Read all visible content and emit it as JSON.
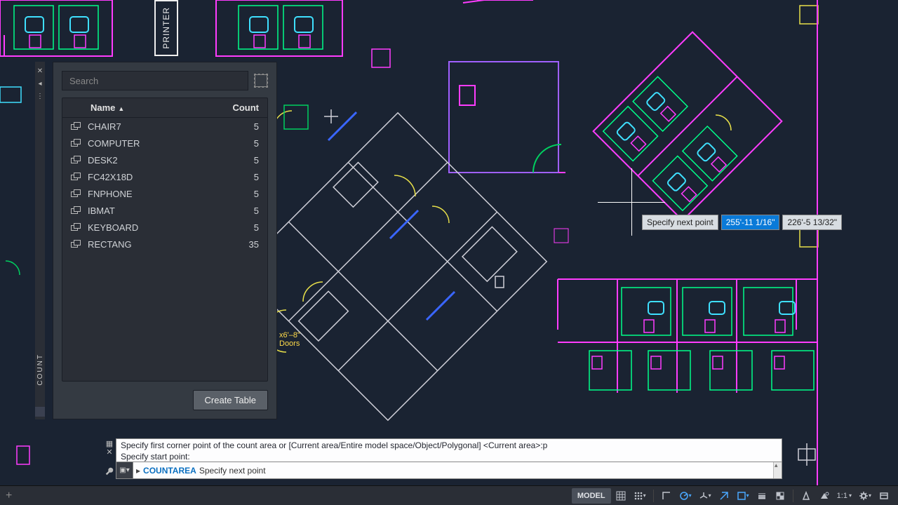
{
  "panel": {
    "side_label": "COUNT",
    "search_placeholder": "Search",
    "columns": {
      "name": "Name",
      "count": "Count"
    },
    "rows": [
      {
        "name": "CHAIR7",
        "count": "5"
      },
      {
        "name": "COMPUTER",
        "count": "5"
      },
      {
        "name": "DESK2",
        "count": "5"
      },
      {
        "name": "FC42X18D",
        "count": "5"
      },
      {
        "name": "FNPHONE",
        "count": "5"
      },
      {
        "name": "IBMAT",
        "count": "5"
      },
      {
        "name": "KEYBOARD",
        "count": "5"
      },
      {
        "name": "RECTANG",
        "count": "35"
      }
    ],
    "create_table": "Create Table"
  },
  "cursor": {
    "prompt_label": "Specify next point",
    "coord_x": "255'-11 1/16\"",
    "coord_y": "226'-5 13/32\""
  },
  "command": {
    "history_line1": "Specify first corner point of the count area or [Current area/Entire model space/Object/Polygonal] <Current area>:p",
    "history_line2": "Specify start point:",
    "current_cmd": "COUNTAREA",
    "current_prompt": "Specify next point"
  },
  "statusbar": {
    "model": "MODEL",
    "scale": "1:1"
  },
  "annotations": {
    "printer": "PRINTER",
    "doors1": "x6'–8\"",
    "doors2": "Doors"
  }
}
